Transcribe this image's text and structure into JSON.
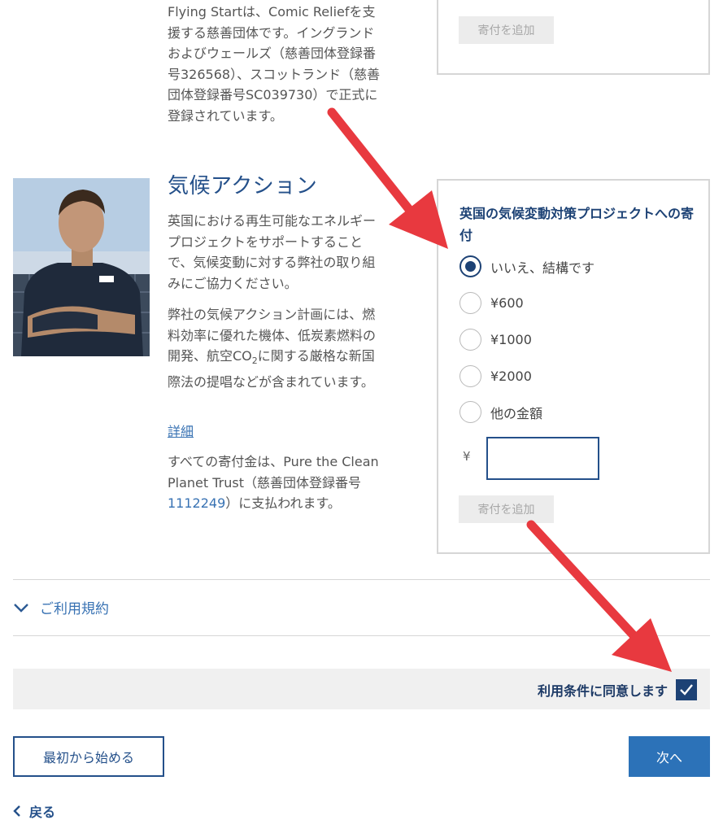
{
  "charity_top": {
    "description": "Flying Startは、Comic Reliefを支援する慈善団体です。イングランドおよびウェールズ（慈善団体登録番号326568）、スコットランド（慈善団体登録番号SC039730）で正式に登録されています。",
    "add_button": "寄付を追加"
  },
  "climate": {
    "title": "気候アクション",
    "desc1": "英国における再生可能なエネルギープロジェクトをサポートすることで、気候変動に対する弊社の取り組みにご協力ください。",
    "desc2_pre": "弊社の気候アクション計画には、燃料効率に優れた機体、低炭素燃料の開発、航空CO",
    "desc2_sub": "2",
    "desc2_post": "に関する厳格な新国際法の提唱などが含まれています。",
    "details_link": "詳細",
    "desc3_pre": "すべての寄付金は、Pure the Clean Planet Trust（慈善団体登録番号",
    "desc3_num": "1112249",
    "desc3_post": "）に支払われます。"
  },
  "donation_box": {
    "title": "英国の気候変動対策プロジェクトへの寄付",
    "options": [
      {
        "label": "いいえ、結構です",
        "checked": true
      },
      {
        "label": "¥600",
        "checked": false
      },
      {
        "label": "¥1000",
        "checked": false
      },
      {
        "label": "¥2000",
        "checked": false
      },
      {
        "label": "他の金額",
        "checked": false
      }
    ],
    "currency": "¥",
    "amount_value": "",
    "add_button": "寄付を追加"
  },
  "terms": {
    "toggle_label": "ご利用規約",
    "agree_label": "利用条件に同意します",
    "agreed": true
  },
  "footer": {
    "restart": "最初から始める",
    "next": "次へ",
    "back": "戻る"
  },
  "colors": {
    "primary": "#24508a",
    "next_button": "#2c72b8",
    "annotation_arrow": "#e8393f"
  }
}
